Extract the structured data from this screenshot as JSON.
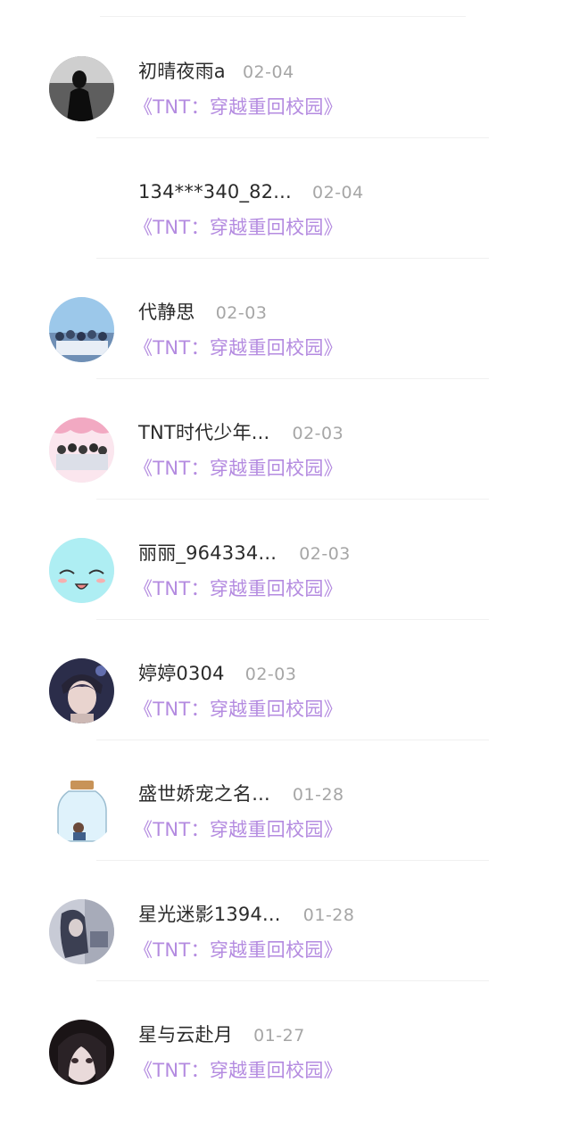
{
  "comments": [
    {
      "name": "初晴夜雨a",
      "date": "02-04",
      "book": "《TNT：穿越重回校园》",
      "avatar": "avatar-silhouette"
    },
    {
      "name": "134***340_82...",
      "date": "02-04",
      "book": "《TNT：穿越重回校园》",
      "avatar": "avatar-none"
    },
    {
      "name": "代静思",
      "date": "02-03",
      "book": "《TNT：穿越重回校园》",
      "avatar": "avatar-group-photo"
    },
    {
      "name": "TNT时代少年...",
      "date": "02-03",
      "book": "《TNT：穿越重回校园》",
      "avatar": "avatar-group-pink"
    },
    {
      "name": "丽丽_964334...",
      "date": "02-03",
      "book": "《TNT：穿越重回校园》",
      "avatar": "avatar-smile-face"
    },
    {
      "name": "婷婷0304",
      "date": "02-03",
      "book": "《TNT：穿越重回校园》",
      "avatar": "avatar-portrait"
    },
    {
      "name": "盛世娇宠之名...",
      "date": "01-28",
      "book": "《TNT：穿越重回校园》",
      "avatar": "avatar-jar"
    },
    {
      "name": "星光迷影1394...",
      "date": "01-28",
      "book": "《TNT：穿越重回校园》",
      "avatar": "avatar-dark-figure"
    },
    {
      "name": "星与云赴月",
      "date": "01-27",
      "book": "《TNT：穿越重回校园》",
      "avatar": "avatar-anime-girl"
    }
  ],
  "colors": {
    "name": "#2b2b2b",
    "date": "#a6a6a6",
    "book": "#b48be0",
    "divider": "#f0f0f0"
  }
}
